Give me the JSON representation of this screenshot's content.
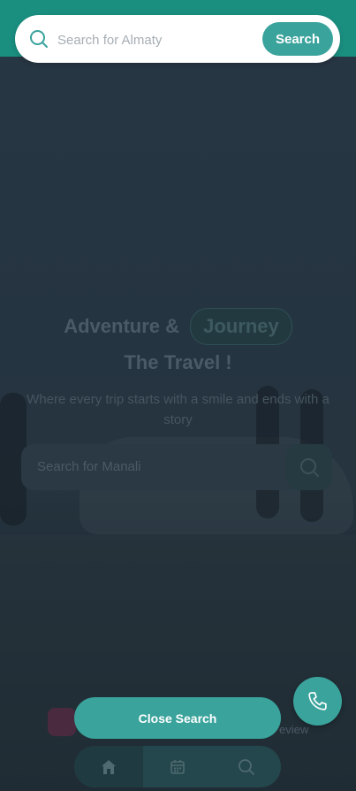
{
  "search_overlay": {
    "placeholder": "Search for Almaty",
    "button_label": "Search",
    "close_label": "Close Search"
  },
  "hero": {
    "title_part1": "Adventure &",
    "title_pill": "Journey",
    "title_line2": "The Travel !",
    "subtitle": "Where every trip starts with a smile and ends with a story",
    "search_placeholder": "Search for Manali"
  },
  "footer": {
    "review_text": "eview"
  },
  "bottom_nav": {
    "items": [
      {
        "icon": "home-icon",
        "active": true
      },
      {
        "icon": "calendar-icon",
        "active": false
      },
      {
        "icon": "search-icon",
        "active": false
      }
    ]
  },
  "colors": {
    "accent": "#3aa39c",
    "topbar": "#1a8f80",
    "overlay": "#1d2b36"
  }
}
